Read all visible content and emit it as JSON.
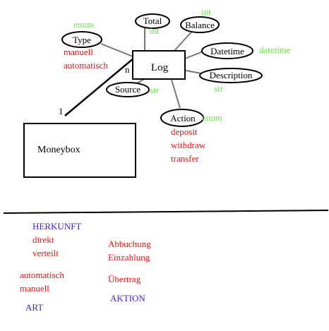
{
  "colors": {
    "ink": "#000000",
    "type_green": "#66ee44",
    "value_red": "#ee1111",
    "heading_blue": "#4422dd",
    "edge_gray": "#777777"
  },
  "entities": {
    "log": {
      "label": "Log"
    },
    "moneybox": {
      "label": "Moneybox"
    }
  },
  "relationship": {
    "log_cardinality": "n",
    "moneybox_cardinality": "1"
  },
  "attributes": {
    "total": {
      "name": "Total",
      "type": "int"
    },
    "balance": {
      "name": "Balance",
      "type": "int"
    },
    "type": {
      "name": "Type",
      "type": "enum",
      "values": [
        "manuell",
        "automatisch"
      ]
    },
    "datetime": {
      "name": "Datetime",
      "type": "datetime"
    },
    "description": {
      "name": "Description",
      "type": "str"
    },
    "source": {
      "name": "Source",
      "type": "str"
    },
    "action": {
      "name": "Action",
      "type": "enum",
      "values": [
        "deposit",
        "withdraw",
        "transfer"
      ]
    }
  },
  "legend": {
    "herkunft": {
      "title": "HERKUNFT",
      "values": [
        "direkt",
        "verteilt"
      ]
    },
    "art": {
      "title": "ART",
      "values": [
        "automatisch",
        "manuell"
      ]
    },
    "aktion": {
      "title": "AKTION",
      "values": [
        "Abbuchung",
        "Einzahlung",
        "Übertrag"
      ]
    }
  }
}
